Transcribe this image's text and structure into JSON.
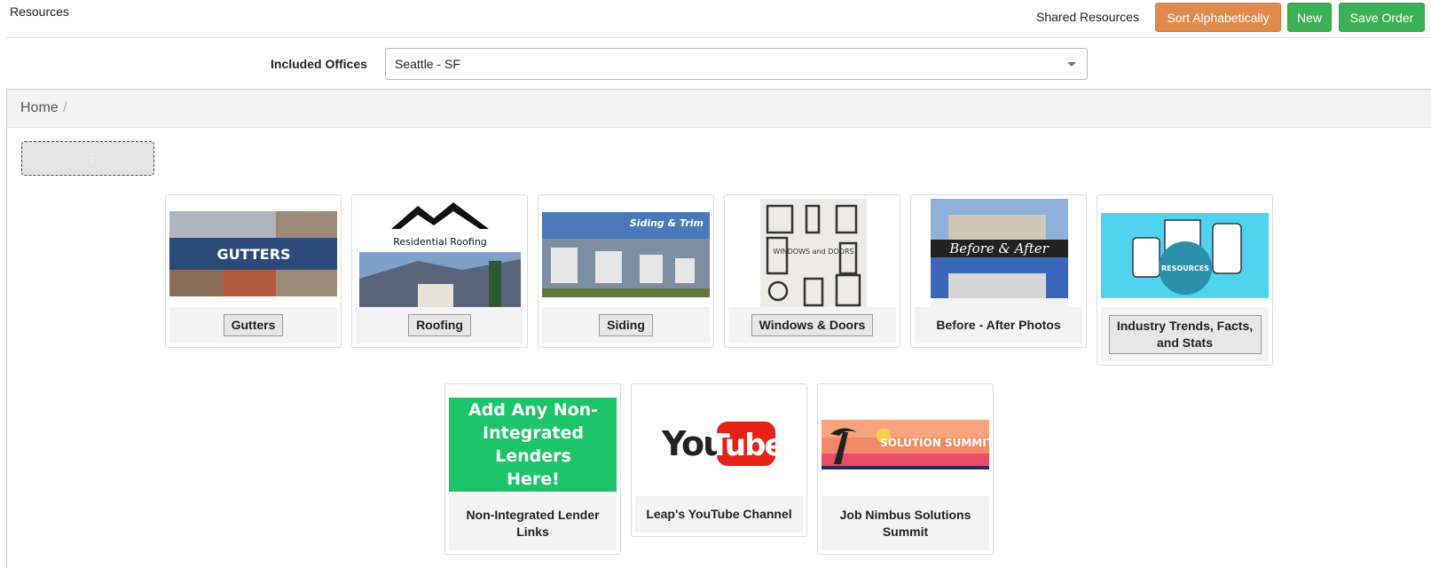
{
  "header": {
    "title": "Resources",
    "shared_link": "Shared Resources",
    "sort_button": "Sort Alphabetically",
    "new_button": "New",
    "save_button": "Save Order"
  },
  "filter": {
    "label": "Included Offices",
    "selected": "Seattle - SF"
  },
  "breadcrumb": {
    "home": "Home",
    "separator": "/"
  },
  "drop_zone": {
    "handle": "⋮"
  },
  "colors": {
    "orange": "#e08a4e",
    "green": "#3cb054",
    "lender_green": "#1dc46a",
    "youtube_red": "#e62117",
    "resources_cyan": "#4fd3ef"
  },
  "resources": [
    {
      "label": "Gutters",
      "thumb_text": "GUTTERS"
    },
    {
      "label": "Roofing",
      "thumb_text": "Residential Roofing"
    },
    {
      "label": "Siding",
      "thumb_text": "Siding & Trim"
    },
    {
      "label": "Windows & Doors",
      "thumb_text": "WINDOWS and DOORS"
    },
    {
      "label": "Before - After Photos",
      "thumb_text": "Before & After"
    },
    {
      "label": "Industry Trends, Facts, and Stats",
      "thumb_text": "RESOURCES"
    },
    {
      "label": "Non-Integrated Lender Links",
      "thumb_text": "Add Any Non-Integrated Lenders Here!"
    },
    {
      "label": "Leap's YouTube Channel",
      "thumb_text": "YouTube"
    },
    {
      "label": "Job Nimbus Solutions Summit",
      "thumb_text": "SOLUTION SUMMIT"
    }
  ]
}
